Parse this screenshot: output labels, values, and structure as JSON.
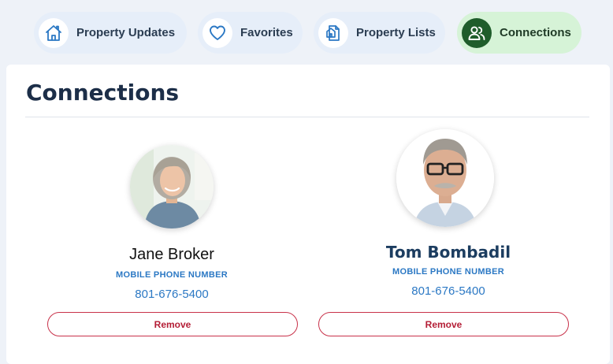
{
  "tabs": [
    {
      "label": "Property Updates",
      "icon": "home-icon",
      "active": false
    },
    {
      "label": "Favorites",
      "icon": "heart-icon",
      "active": false
    },
    {
      "label": "Property Lists",
      "icon": "document-list-icon",
      "active": false
    },
    {
      "label": "Connections",
      "icon": "users-icon",
      "active": true
    }
  ],
  "panel": {
    "title": "Connections"
  },
  "connections": [
    {
      "name": "Jane Broker",
      "phone_label": "MOBILE PHONE NUMBER",
      "phone": "801-676-5400",
      "remove_label": "Remove",
      "avatar": "woman-portrait-photo"
    },
    {
      "name": "Tom Bombadil",
      "phone_label": "MOBILE PHONE NUMBER",
      "phone": "801-676-5400",
      "remove_label": "Remove",
      "avatar": "man-portrait-photo"
    }
  ],
  "colors": {
    "accent_blue": "#2b78c4",
    "remove_red": "#c8324a",
    "active_tab_bg": "#d6f3d7",
    "active_icon_bg": "#1f5d2b",
    "tab_bg": "#e6eef9"
  }
}
